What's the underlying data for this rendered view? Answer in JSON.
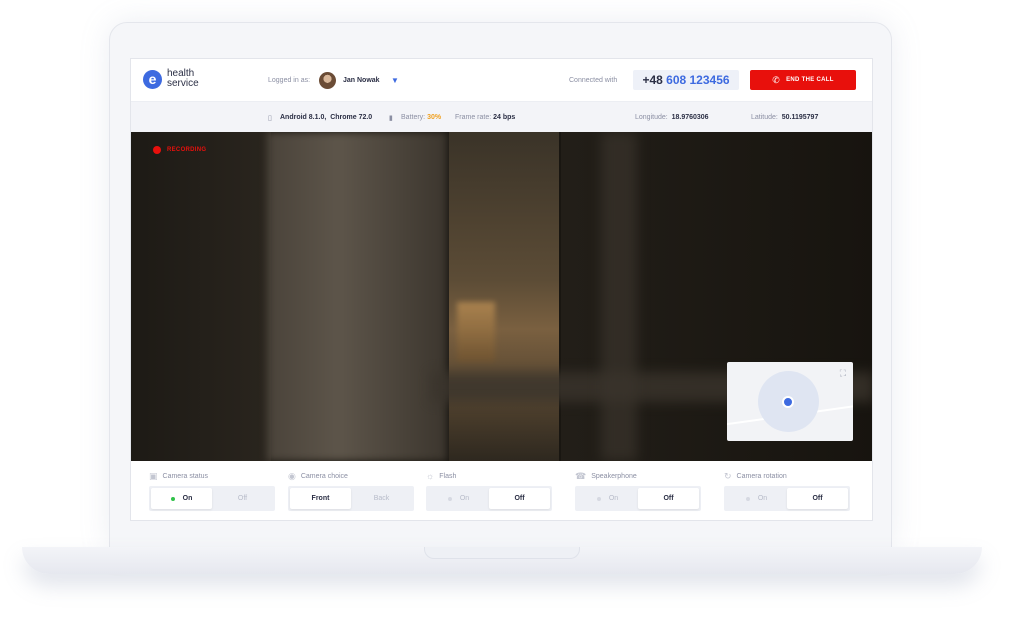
{
  "header": {
    "logo_text_line1": "health",
    "logo_text_line2": "service",
    "logged_in_label": "Logged in as:",
    "user_name": "Jan Nowak",
    "connected_label": "Connected with",
    "phone_prefix": "+48",
    "phone_number": "608 123456",
    "end_call_label": "END THE CALL"
  },
  "info": {
    "device": "Android 8.1.0,",
    "browser": "Chrome 72.0",
    "battery_label": "Battery:",
    "battery_value": "30%",
    "frame_rate_label": "Frame rate:",
    "frame_rate_value": "24 bps",
    "longitude_label": "Longitude:",
    "longitude_value": "18.9760306",
    "latitude_label": "Latitude:",
    "latitude_value": "50.1195797"
  },
  "video": {
    "recording_label": "RECORDING"
  },
  "controls": [
    {
      "label": "Camera status",
      "icon": "camera-icon",
      "options": [
        "On",
        "Off"
      ],
      "selected": 0
    },
    {
      "label": "Camera choice",
      "icon": "camera-switch-icon",
      "options": [
        "Front",
        "Back"
      ],
      "selected": 0
    },
    {
      "label": "Flash",
      "icon": "flash-icon",
      "options": [
        "On",
        "Off"
      ],
      "selected": 1
    },
    {
      "label": "Speakerphone",
      "icon": "speaker-icon",
      "options": [
        "On",
        "Off"
      ],
      "selected": 1
    },
    {
      "label": "Camera rotation",
      "icon": "rotate-icon",
      "options": [
        "On",
        "Off"
      ],
      "selected": 1
    }
  ],
  "colors": {
    "brand": "#3d6ae0",
    "end_call": "#e8100c",
    "battery": "#f0a020",
    "active_led": "#31c24a"
  }
}
